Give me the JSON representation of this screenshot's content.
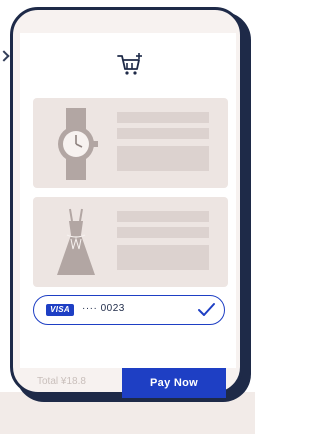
{
  "checkout": {
    "cart_icon": "shopping-cart-add-icon",
    "items": [
      {
        "thumbnail_icon": "wristwatch-icon"
      },
      {
        "thumbnail_icon": "dress-icon"
      }
    ],
    "payment": {
      "brand": "VISA",
      "card_number": "···· 0023",
      "selected_icon": "checkmark-icon"
    },
    "total_label": "Total ¥18.8",
    "pay_button_label": "Pay Now"
  },
  "colors": {
    "accent": "#1e3fc4",
    "frame": "#1e2a48",
    "card_bg": "#ede5e2",
    "placeholder": "#dcd2cf"
  }
}
